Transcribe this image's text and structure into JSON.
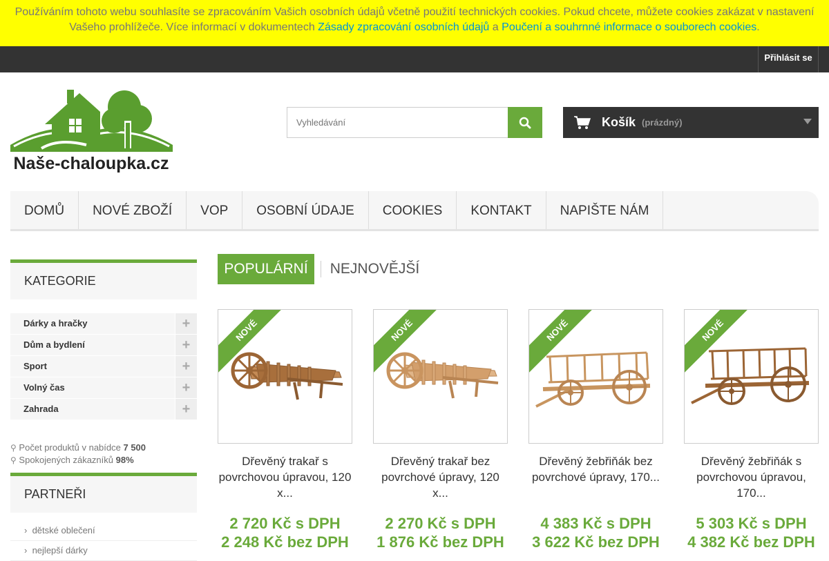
{
  "cookie_bar": {
    "text_before": "Používáním tohoto webu souhlasíte se zpracováním Vašich osobních údajů včetně použití technických cookies. Pokud chcete, můžete cookies zakázat v nastavení Vašeho prohlížeče. Více informací v dokumentech",
    "link1": "Zásady zpracování osobních údajů",
    "and": "a",
    "link2": "Poučení a souhrnné informace o souborech cookies",
    "text_after": "."
  },
  "topbar": {
    "login": "Přihlásit se"
  },
  "header": {
    "logo_text": "Naše-chaloupka.cz",
    "search_placeholder": "Vyhledávání",
    "cart_label": "Košík",
    "cart_status": "(prázdný)"
  },
  "nav": {
    "items": [
      {
        "label": "Domů"
      },
      {
        "label": "Nové zboží"
      },
      {
        "label": "VOP"
      },
      {
        "label": "Osobní údaje"
      },
      {
        "label": "Cookies"
      },
      {
        "label": "Kontakt"
      },
      {
        "label": "Napište nám"
      }
    ]
  },
  "sidebar": {
    "categories_title": "Kategorie",
    "categories": [
      {
        "label": "Dárky a hračky"
      },
      {
        "label": "Dům a bydlení"
      },
      {
        "label": "Sport"
      },
      {
        "label": "Volný čas"
      },
      {
        "label": "Zahrada"
      }
    ],
    "stats": {
      "products_label": "Počet produktů v nabídce",
      "products_value": "7 500",
      "customers_label": "Spokojených zákazníků",
      "customers_value": "98%"
    },
    "partners_title": "Partneři",
    "partners": [
      {
        "label": "dětské oblečení"
      },
      {
        "label": "nejlepší dárky"
      }
    ]
  },
  "tabs": {
    "popular": "Populární",
    "newest": "Nejnovější"
  },
  "products": [
    {
      "badge": "Nové",
      "name": "Dřevěný trakař s povrchovou úpravou, 120 x...",
      "price_vat": "2 720 Kč s DPH",
      "price_novat": "2 248 Kč bez DPH"
    },
    {
      "badge": "Nové",
      "name": "Dřevěný trakař bez povrchové úpravy, 120 x...",
      "price_vat": "2 270 Kč s DPH",
      "price_novat": "1 876 Kč bez DPH"
    },
    {
      "badge": "Nové",
      "name": "Dřevěný žebřiňák bez povrchové úpravy, 170...",
      "price_vat": "4 383 Kč s DPH",
      "price_novat": "3 622 Kč bez DPH"
    },
    {
      "badge": "Nové",
      "name": "Dřevěný žebřiňák s povrchovou úpravou, 170...",
      "price_vat": "5 303 Kč s DPH",
      "price_novat": "4 382 Kč bez DPH"
    }
  ],
  "colors": {
    "accent": "#6aaa3b",
    "cookie_bg": "#ffff00",
    "dark": "#333333"
  }
}
